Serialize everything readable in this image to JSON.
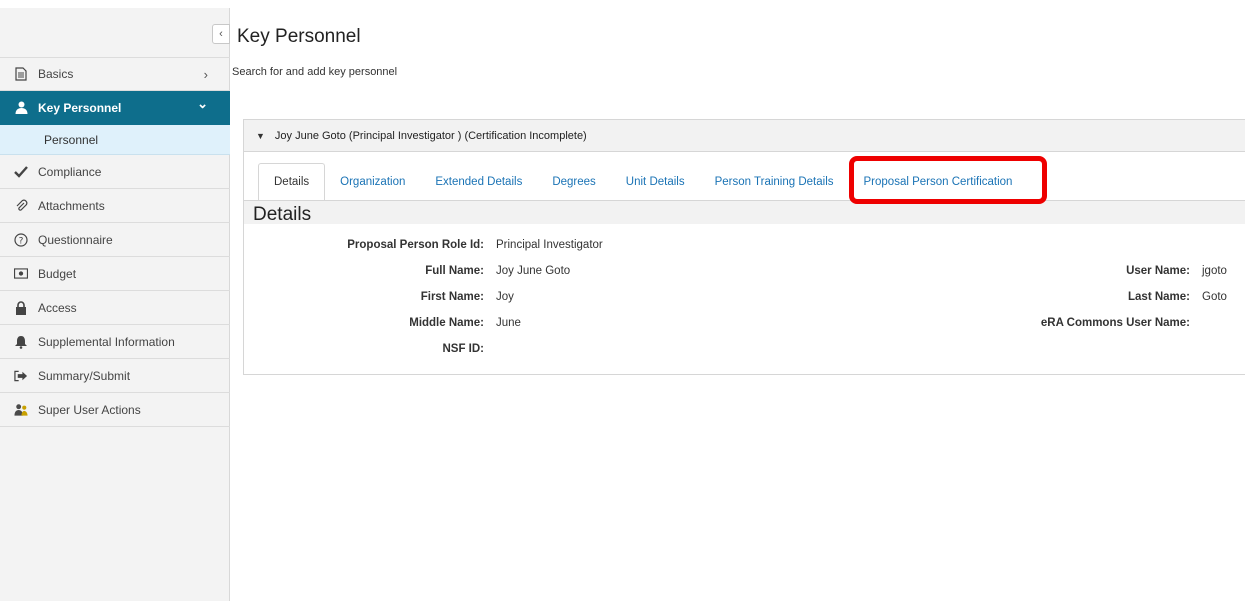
{
  "sidebar": {
    "collapse_glyph": "‹",
    "items": [
      {
        "label": "Basics",
        "icon": "document-icon",
        "chevron": "›"
      },
      {
        "label": "Key Personnel",
        "icon": "person-icon",
        "chevron": "⌄"
      },
      {
        "label": "Compliance",
        "icon": "check-icon"
      },
      {
        "label": "Attachments",
        "icon": "paperclip-icon"
      },
      {
        "label": "Questionnaire",
        "icon": "question-circle-icon"
      },
      {
        "label": "Budget",
        "icon": "money-icon"
      },
      {
        "label": "Access",
        "icon": "lock-icon"
      },
      {
        "label": "Supplemental Information",
        "icon": "bell-icon"
      },
      {
        "label": "Summary/Submit",
        "icon": "submit-icon"
      },
      {
        "label": "Super User Actions",
        "icon": "users-icon"
      }
    ],
    "sub_items": [
      {
        "label": "Personnel"
      }
    ]
  },
  "main": {
    "title": "Key Personnel",
    "subtitle": "Search for and add key personnel",
    "panel": {
      "header": "Joy June Goto (Principal Investigator ) (Certification Incomplete)",
      "tabs": [
        {
          "label": "Details"
        },
        {
          "label": "Organization"
        },
        {
          "label": "Extended Details"
        },
        {
          "label": "Degrees"
        },
        {
          "label": "Unit Details"
        },
        {
          "label": "Person Training Details"
        },
        {
          "label": "Proposal Person Certification"
        }
      ],
      "details_heading": "Details",
      "fields": {
        "role_label": "Proposal Person Role Id:",
        "role_value": "Principal Investigator",
        "full_name_label": "Full Name:",
        "full_name_value": "Joy June Goto",
        "first_name_label": "First Name:",
        "first_name_value": "Joy",
        "middle_name_label": "Middle Name:",
        "middle_name_value": "June",
        "nsf_label": "NSF ID:",
        "nsf_value": "",
        "user_name_label": "User Name:",
        "user_name_value": "jgoto",
        "last_name_label": "Last Name:",
        "last_name_value": "Goto",
        "era_label": "eRA Commons User Name:",
        "era_value": ""
      }
    }
  },
  "colors": {
    "accent": "#0e6e8c",
    "link": "#1a73b5",
    "highlight": "#ee0000",
    "sub_item_bg": "#dff1fb"
  }
}
